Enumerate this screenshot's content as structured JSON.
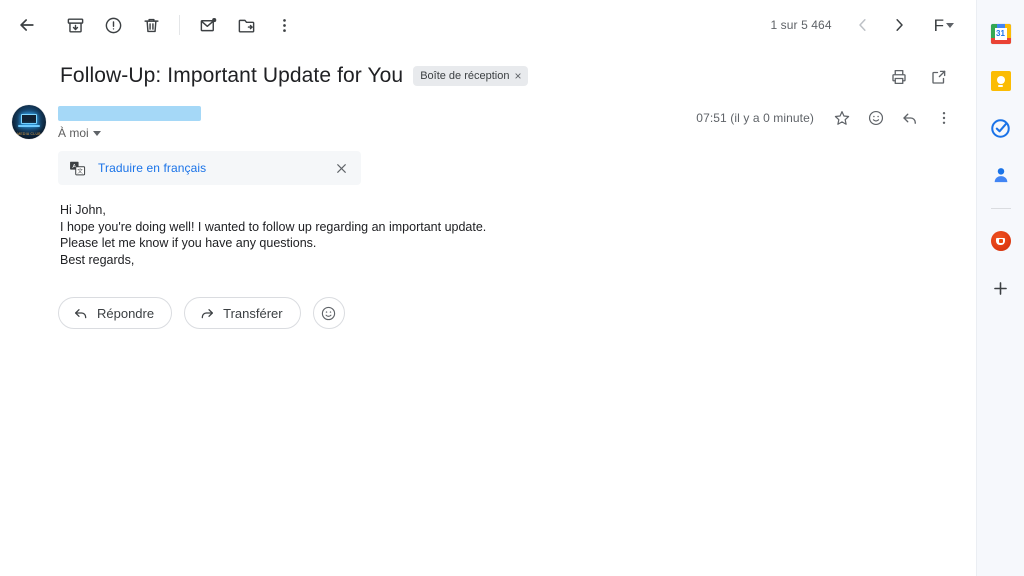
{
  "toolbar": {
    "back": {
      "label": "Retour",
      "icon": "arrow-back-icon"
    },
    "archive": {
      "label": "Archiver",
      "icon": "archive-icon"
    },
    "spam": {
      "label": "Signaler comme spam",
      "icon": "report-spam-icon"
    },
    "delete": {
      "label": "Supprimer",
      "icon": "delete-icon"
    },
    "mark_unread": {
      "label": "Marquer comme non lu",
      "icon": "mark-unread-icon"
    },
    "move_to": {
      "label": "Déplacer vers",
      "icon": "move-to-folder-icon"
    },
    "more": {
      "label": "Plus",
      "icon": "more-vert-icon"
    },
    "page_count": "1 sur 5 464",
    "prev": {
      "label": "Plus récent",
      "icon": "chevron-left-icon"
    },
    "next": {
      "label": "Plus ancien",
      "icon": "chevron-right-icon"
    },
    "font_size": {
      "glyph": "F",
      "label": "Taille de police",
      "icon": "font-size-icon"
    }
  },
  "subject": {
    "title": "Follow-Up: Important Update for You",
    "label": "Boîte de réception",
    "label_remove": "×",
    "print": {
      "label": "Imprimer",
      "icon": "print-icon"
    },
    "open_new": {
      "label": "Ouvrir dans une nouvelle fenêtre",
      "icon": "open-in-new-icon"
    }
  },
  "message_header": {
    "avatar": {
      "label": "Photo de profil de l'expéditeur",
      "alt_text": "MEDIA CLUB"
    },
    "sender_redacted": true,
    "recipient": "À moi",
    "timestamp": "07:51 (il y a 0 minute)",
    "star": {
      "label": "Suivi",
      "icon": "star-outline-icon"
    },
    "react": {
      "label": "Ajouter une réaction",
      "icon": "emoji-smile-icon"
    },
    "reply": {
      "label": "Répondre",
      "icon": "reply-icon"
    },
    "more": {
      "label": "Plus",
      "icon": "more-vert-icon"
    }
  },
  "translate": {
    "icon": "translate-icon",
    "link": "Traduire en français",
    "close": {
      "label": "Fermer",
      "icon": "close-icon"
    }
  },
  "body_lines": [
    "Hi John,",
    "I hope you're doing well! I wanted to follow up regarding an important update.",
    "Please let me know if you have any questions.",
    "Best regards,"
  ],
  "actions": {
    "reply": {
      "label": "Répondre",
      "icon": "reply-icon"
    },
    "forward": {
      "label": "Transférer",
      "icon": "forward-icon"
    },
    "emoji": {
      "label": "Réagir avec un emoji",
      "icon": "emoji-smile-icon"
    }
  },
  "side_panel": {
    "calendar": {
      "label": "Google Agenda",
      "icon": "google-calendar-icon",
      "day": "31"
    },
    "keep": {
      "label": "Google Keep",
      "icon": "google-keep-icon"
    },
    "tasks": {
      "label": "Google Tasks",
      "icon": "google-tasks-icon"
    },
    "contacts": {
      "label": "Contacts",
      "icon": "google-contacts-icon"
    },
    "addon": {
      "label": "Module complémentaire",
      "icon": "marketplace-addon-icon"
    },
    "add": {
      "label": "Obtenir des modules complémentaires",
      "icon": "plus-icon"
    }
  },
  "colors": {
    "accent_blue": "#1a73e8",
    "redaction": "#a5d8f7",
    "chip_bg": "#e8eaed",
    "panel_bg": "#f6f8fc",
    "text": "#202124",
    "muted": "#5f6368"
  }
}
